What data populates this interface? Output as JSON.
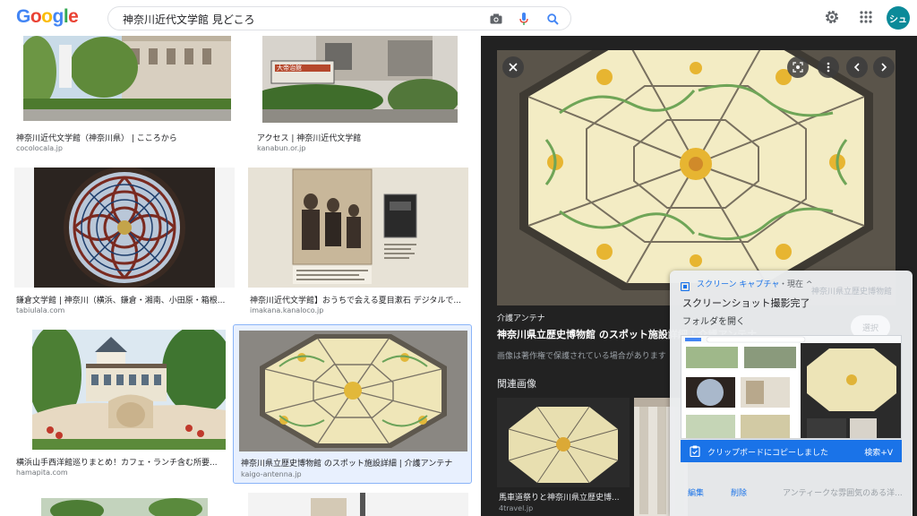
{
  "search": {
    "query": "神奈川近代文学館 見どころ"
  },
  "header": {
    "avatar_text": "シュ"
  },
  "results": [
    {
      "caption": "神奈川近代文学館（神奈川県） | こころから",
      "source": "cocolocala.jp"
    },
    {
      "caption": "アクセス | 神奈川近代文学館",
      "source": "kanabun.or.jp"
    },
    {
      "caption": "鎌倉文学館 | 神奈川（横浜、鎌倉・湘南、小田原・箱根...",
      "source": "tabiulala.com"
    },
    {
      "caption": "神奈川近代文学館】おうちで会える夏目漱石 デジタルで...",
      "source": "imakana.kanaloco.jp"
    },
    {
      "caption": "横浜山手西洋館巡りまとめ！カフェ・ランチ含む所要...",
      "source": "hamapita.com"
    },
    {
      "caption": "神奈川県立歴史博物館 のスポット施設詳細 | 介護アンテナ",
      "source": "kaigo-antenna.jp"
    }
  ],
  "thumb_text": {
    "sign": "大帝治館"
  },
  "panel": {
    "source_name": "介護アンテナ",
    "title": "神奈川県立歴史博物館 のスポット施設詳細 | 介護アンテナ",
    "note": "画像は著作権で保護されている場合があります",
    "related_heading": "関連画像",
    "related_caption": "馬車道祭りと神奈川県立歴史博...",
    "related_source": "4travel.jp",
    "related_caption_2": "アンティークな雰囲気のある洋..."
  },
  "notification": {
    "app_name": "スクリーン キャプチャ",
    "time": "・現在 ^",
    "overlay_text": "神奈川県立歴史博物館",
    "title": "スクリーンショット撮影完了",
    "subtitle": "フォルダを開く",
    "button_label": "選択",
    "toast_text": "クリップボードにコピーしました",
    "shortcut": "検索+V",
    "edit_label": "編集",
    "delete_label": "削除"
  },
  "colors": {
    "accent": "#1a73e8",
    "panel_bg": "#222222",
    "selected_border": "#8ab4f8"
  }
}
